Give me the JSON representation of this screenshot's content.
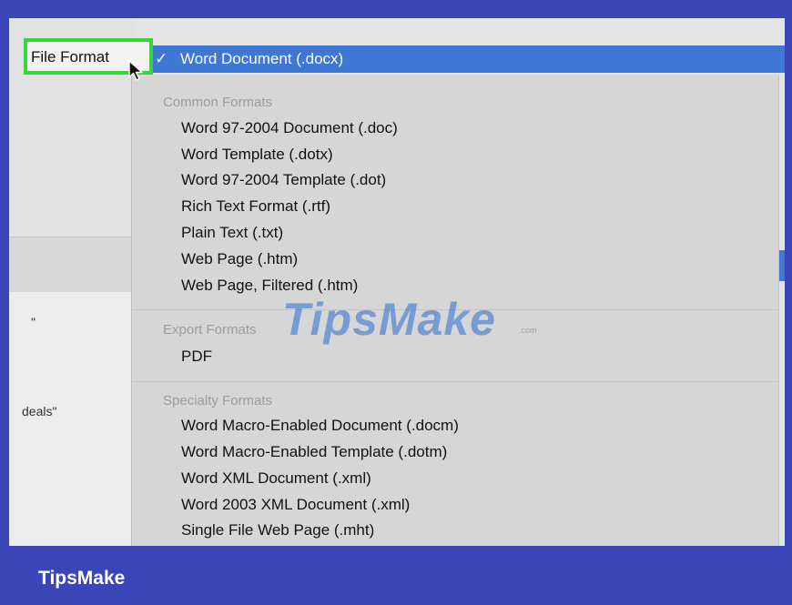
{
  "format_label": "File Format",
  "selected_format": "Word Document (.docx)",
  "selected_check": "✓",
  "left_snippets": [
    "\"",
    "deals\""
  ],
  "sections": [
    {
      "title": "Common Formats",
      "items": [
        "Word 97-2004 Document (.doc)",
        "Word Template (.dotx)",
        "Word 97-2004 Template (.dot)",
        "Rich Text Format (.rtf)",
        "Plain Text (.txt)",
        "Web Page (.htm)",
        "Web Page, Filtered (.htm)"
      ]
    },
    {
      "title": "Export Formats",
      "items": [
        "PDF"
      ]
    },
    {
      "title": "Specialty Formats",
      "items": [
        "Word Macro-Enabled Document (.docm)",
        "Word Macro-Enabled Template (.dotm)",
        "Word XML Document (.xml)",
        "Word 2003 XML Document (.xml)",
        "Single File Web Page (.mht)"
      ]
    }
  ],
  "watermark": "TipsMake",
  "watermark_sub": ".com",
  "footer_brand": "TipsMake",
  "colors": {
    "highlight": "#3e78d4",
    "background_border": "#3a45b8",
    "label_outline": "#3bd33b"
  }
}
